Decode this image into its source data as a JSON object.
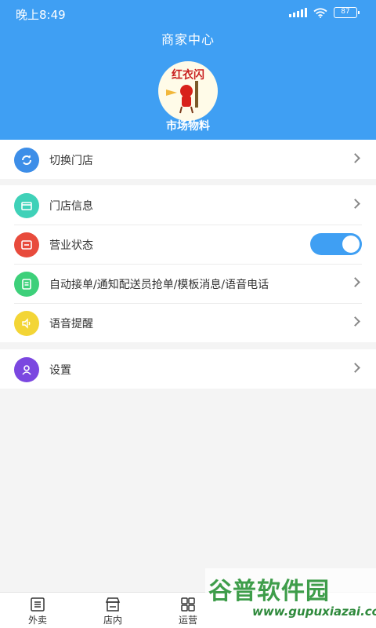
{
  "status_bar": {
    "time": "晚上8:49",
    "battery": "87"
  },
  "header": {
    "title": "商家中心",
    "store_name": "市场物料",
    "avatar_text": "红衣闪"
  },
  "menu": {
    "switch_store": {
      "label": "切换门店",
      "icon": "refresh-icon",
      "color": "#3d8ee8"
    },
    "store_info": {
      "label": "门店信息",
      "icon": "store-icon",
      "color": "#3fd1b8"
    },
    "business_status": {
      "label": "营业状态",
      "icon": "status-icon",
      "color": "#e84b3c",
      "toggle_on": true
    },
    "auto_accept": {
      "label": "自动接单/通知配送员抢单/模板消息/语音电话",
      "icon": "doc-icon",
      "color": "#3dd07a"
    },
    "voice_reminder": {
      "label": "语音提醒",
      "icon": "speaker-icon",
      "color": "#f3d536"
    },
    "settings": {
      "label": "设置",
      "icon": "user-icon",
      "color": "#7b47e0"
    }
  },
  "tabs": [
    {
      "label": "外卖",
      "icon": "list-icon"
    },
    {
      "label": "店内",
      "icon": "shop-icon"
    },
    {
      "label": "运营",
      "icon": "grid-icon"
    }
  ],
  "watermark": {
    "main": "谷普软件园",
    "sub": "www.gupuxiazai.com"
  },
  "colors": {
    "primary": "#3f9ff3",
    "background": "#f4f4f4"
  }
}
